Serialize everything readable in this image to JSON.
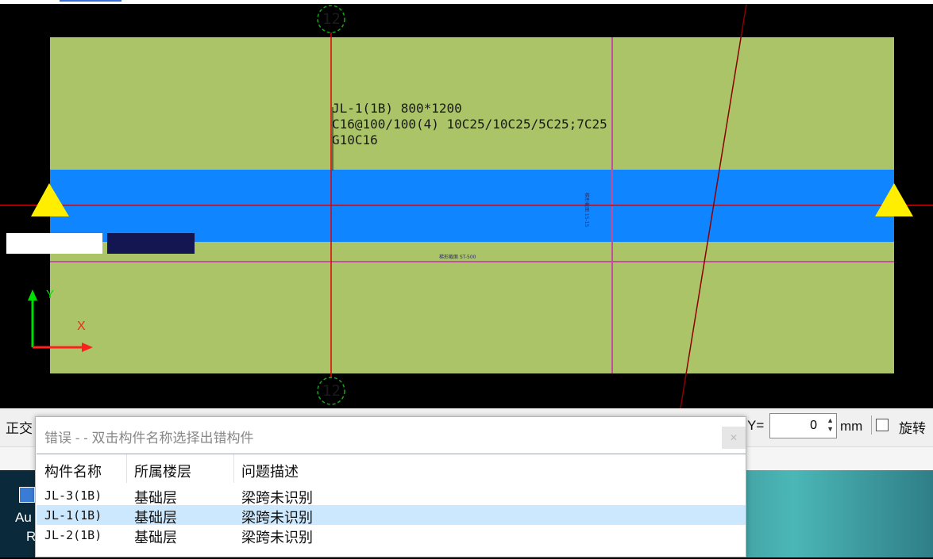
{
  "drawing": {
    "axis_top": "12",
    "axis_bottom": "12",
    "beam_text": [
      "JL-1(1B) 800*1200",
      "C16@100/100(4) 10C25/10C25/5C25;7C25",
      "G10C16"
    ],
    "tiny_labels": [
      "梯形截面 15-15",
      "梯形截面 ST-500"
    ],
    "ucs": {
      "x": "X",
      "y": "Y"
    }
  },
  "statusbar": {
    "ortho": "正交",
    "y_label": "Y=",
    "y_value": "0",
    "unit": "mm",
    "rotate": "旋转"
  },
  "desktop": {
    "icon1": "Au",
    "icon2": "R"
  },
  "dialog": {
    "title": "错误 - - 双击构件名称选择出错构件",
    "columns": [
      "构件名称",
      "所属楼层",
      "问题描述"
    ],
    "rows": [
      {
        "name": "JL-3(1B)",
        "floor": "基础层",
        "issue": "梁跨未识别",
        "selected": false
      },
      {
        "name": "JL-1(1B)",
        "floor": "基础层",
        "issue": "梁跨未识别",
        "selected": true
      },
      {
        "name": "JL-2(1B)",
        "floor": "基础层",
        "issue": "梁跨未识别",
        "selected": false
      }
    ]
  },
  "colors": {
    "slab": "#abc467",
    "beam": "#0f86ff",
    "axis": "#ff0000",
    "grid": "#c04fa0",
    "support": "#ffee00",
    "selection": "#cce8ff"
  }
}
